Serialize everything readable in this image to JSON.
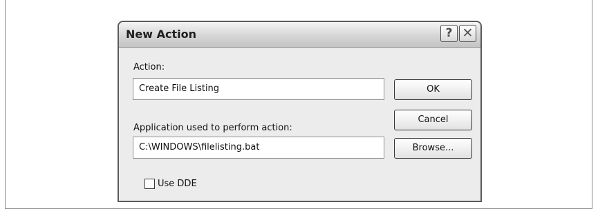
{
  "dialog": {
    "title": "New Action",
    "title_buttons": {
      "help": "?",
      "close": "✕"
    },
    "action": {
      "label": "Action:",
      "value": "Create File Listing"
    },
    "application": {
      "label": "Application used to perform action:",
      "value": "C:\\WINDOWS\\filelisting.bat"
    },
    "buttons": {
      "ok": "OK",
      "cancel": "Cancel",
      "browse": "Browse..."
    },
    "use_dde": {
      "label": "Use DDE",
      "checked": false
    }
  },
  "icons": [
    "help-icon",
    "close-icon"
  ]
}
